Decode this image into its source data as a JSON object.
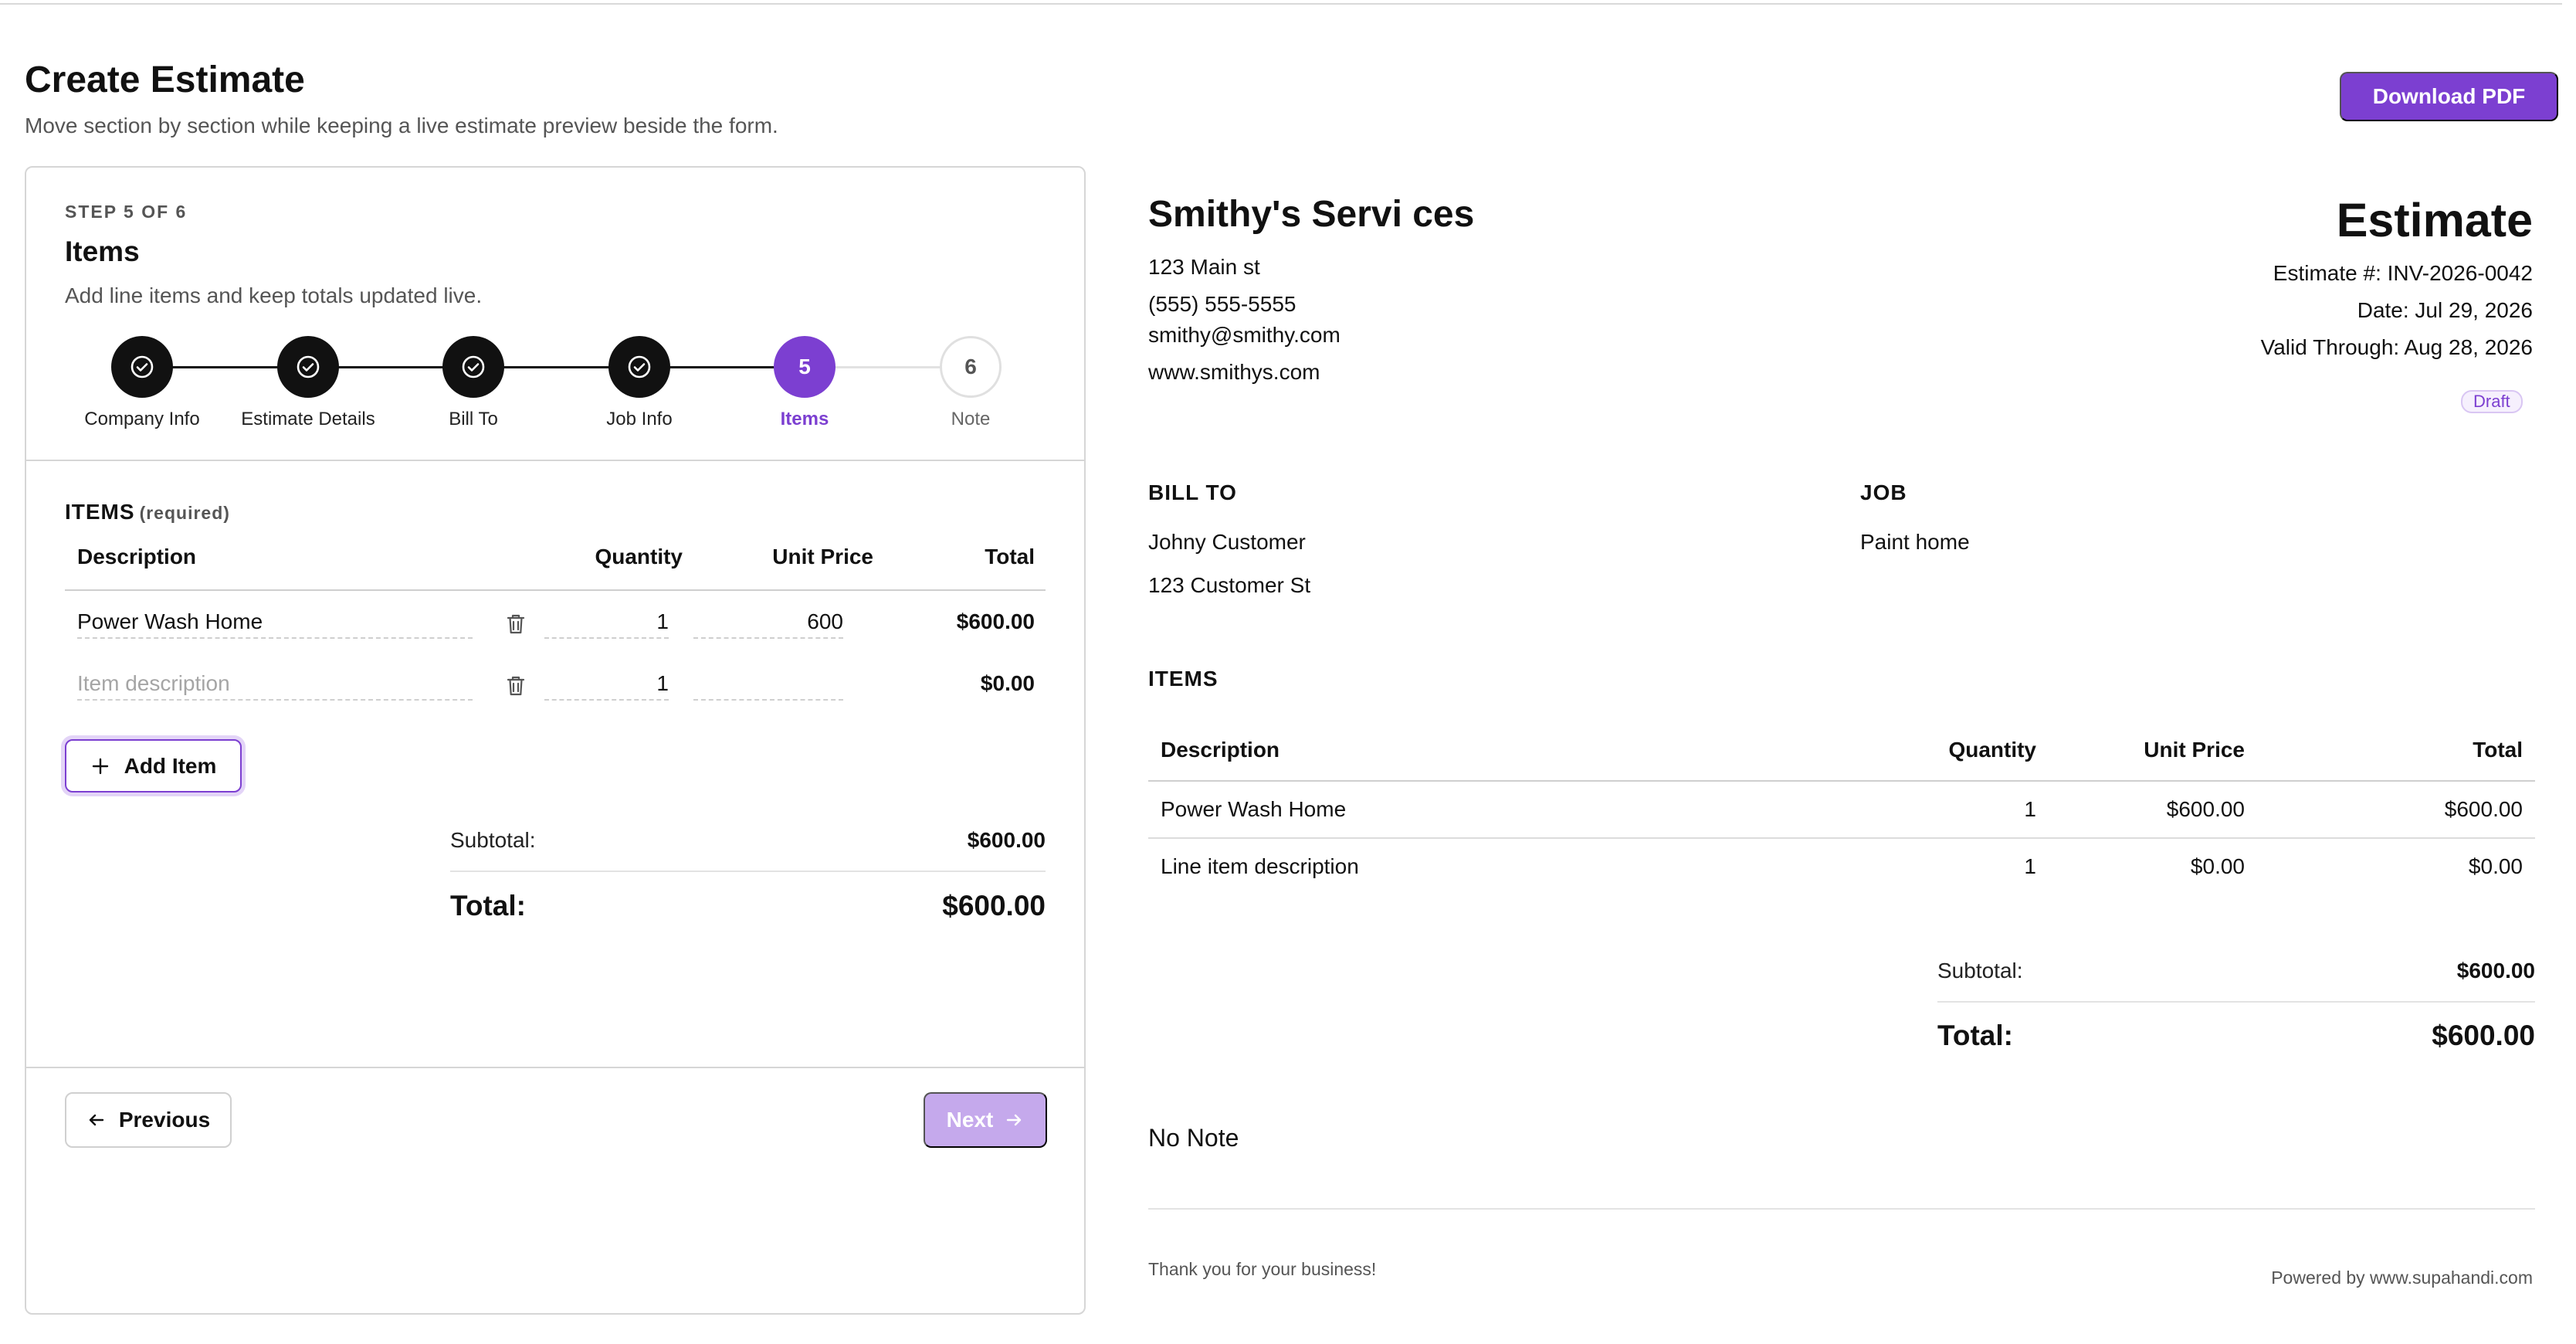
{
  "header": {
    "title": "Create Estimate",
    "subtitle": "Move section by section while keeping a live estimate preview beside the form.",
    "download_label": "Download PDF"
  },
  "form": {
    "step_kicker": "STEP 5 OF 6",
    "step_title": "Items",
    "step_subtitle": "Add line items and keep totals updated live.",
    "steps": [
      {
        "label": "Company Info",
        "state": "done"
      },
      {
        "label": "Estimate Details",
        "state": "done"
      },
      {
        "label": "Bill To",
        "state": "done"
      },
      {
        "label": "Job Info",
        "state": "done"
      },
      {
        "label": "Items",
        "number": "5",
        "state": "active"
      },
      {
        "label": "Note",
        "number": "6",
        "state": "todo"
      }
    ],
    "items_heading": "ITEMS",
    "items_required": "(required)",
    "columns": {
      "description": "Description",
      "quantity": "Quantity",
      "unit_price": "Unit Price",
      "total": "Total"
    },
    "rows": [
      {
        "description": "Power Wash Home",
        "quantity": "1",
        "unit_price": "600",
        "total": "$600.00"
      },
      {
        "description": "",
        "description_placeholder": "Item description",
        "quantity": "1",
        "unit_price": "",
        "total": "$0.00"
      }
    ],
    "add_item_label": "Add Item",
    "subtotal_label": "Subtotal:",
    "subtotal_value": "$600.00",
    "total_label": "Total:",
    "total_value": "$600.00",
    "previous_label": "Previous",
    "next_label": "Next"
  },
  "preview": {
    "company_name": "Smithy's Servi ces",
    "address": "123 Main st",
    "phone": "(555) 555-5555",
    "email": "smithy@smithy.com",
    "website": "www.smithys.com",
    "doc_title": "Estimate",
    "estimate_number": "Estimate #: INV-2026-0042",
    "date": "Date:  Jul 29, 2026",
    "valid_through": "Valid Through:  Aug 28, 2026",
    "status_badge": "Draft",
    "bill_to_heading": "BILL TO",
    "bill_to_name": "Johny Customer",
    "bill_to_address": "123 Customer St",
    "job_heading": "JOB",
    "job_value": "Paint home",
    "items_heading": "ITEMS",
    "columns": {
      "description": "Description",
      "quantity": "Quantity",
      "unit_price": "Unit Price",
      "total": "Total"
    },
    "rows": [
      {
        "description": "Power Wash Home",
        "quantity": "1",
        "unit_price": "$600.00",
        "total": "$600.00"
      },
      {
        "description": "Line item description",
        "quantity": "1",
        "unit_price": "$0.00",
        "total": "$0.00"
      }
    ],
    "subtotal_label": "Subtotal:",
    "subtotal_value": "$600.00",
    "total_label": "Total:",
    "total_value": "$600.00",
    "note": "No Note",
    "thank_you": "Thank you for your business!",
    "powered_by": "Powered by www.supahandi.com"
  },
  "colors": {
    "accent": "#7c3fd1",
    "accent_disabled": "#c5a9ec",
    "text": "#111111",
    "muted": "#555555"
  }
}
